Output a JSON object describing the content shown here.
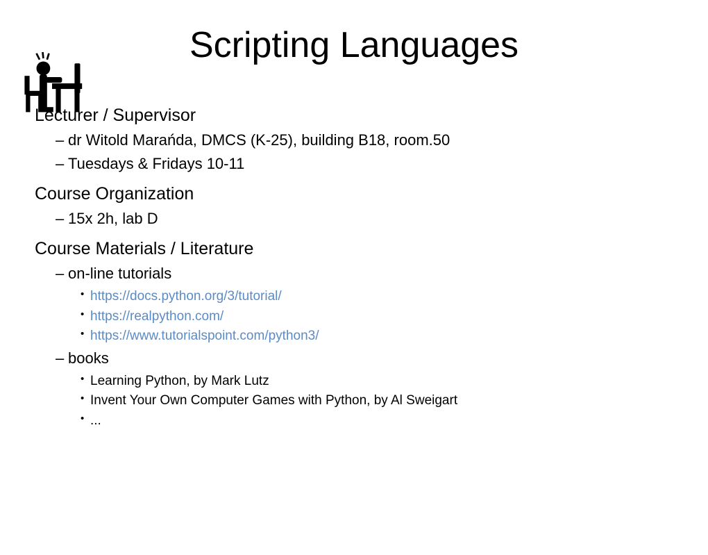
{
  "title": "Scripting Languages",
  "sections": {
    "lecturer": {
      "header": "Lecturer / Supervisor",
      "items": {
        "0": "dr Witold Marańda, DMCS (K-25), building B18, room.50",
        "1": "Tuesdays & Fridays 10-11"
      }
    },
    "organization": {
      "header": "Course Organization",
      "items": {
        "0": "15x 2h, lab D"
      }
    },
    "materials": {
      "header": "Course Materials / Literature",
      "tutorials": {
        "label": "on-line tutorials",
        "links": {
          "0": "https://docs.python.org/3/tutorial/",
          "1": "https://realpython.com/",
          "2": "https://www.tutorialspoint.com/python3/"
        }
      },
      "books": {
        "label": "books",
        "items": {
          "0": "Learning Python, by Mark Lutz",
          "1": "Invent Your Own Computer Games with Python, by Al Sweigart",
          "2": "..."
        }
      }
    }
  }
}
